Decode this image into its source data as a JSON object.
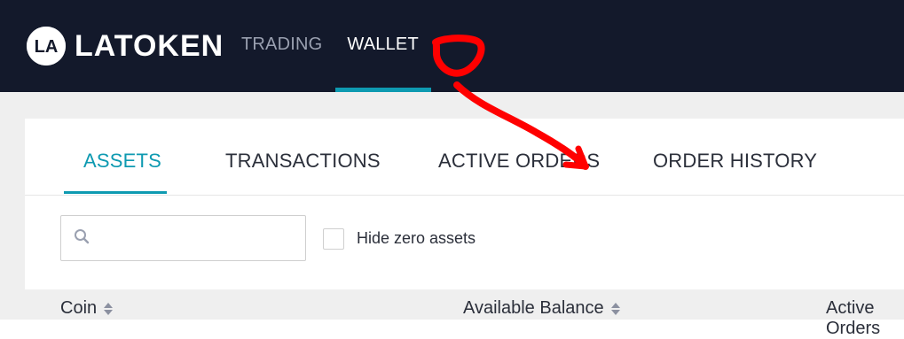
{
  "header": {
    "brand_name": "LATOKEN",
    "logo_text": "LA",
    "nav": [
      {
        "label": "TRADING",
        "active": false
      },
      {
        "label": "WALLET",
        "active": true
      }
    ]
  },
  "wallet": {
    "tabs": [
      {
        "label": "ASSETS",
        "active": true
      },
      {
        "label": "TRANSACTIONS",
        "active": false
      },
      {
        "label": "ACTIVE ORDERS",
        "active": false
      },
      {
        "label": "ORDER HISTORY",
        "active": false
      }
    ],
    "search": {
      "placeholder": "",
      "value": ""
    },
    "hide_zero_label": "Hide zero assets",
    "table": {
      "columns": [
        "Coin",
        "Available Balance",
        "Active Orders"
      ]
    }
  },
  "colors": {
    "header_bg": "#13192b",
    "accent": "#0e9ab1",
    "annotation": "#ff0000"
  },
  "icons": {
    "search": "search-icon",
    "sort": "sort-icon",
    "logo": "latoken-logo-icon"
  }
}
